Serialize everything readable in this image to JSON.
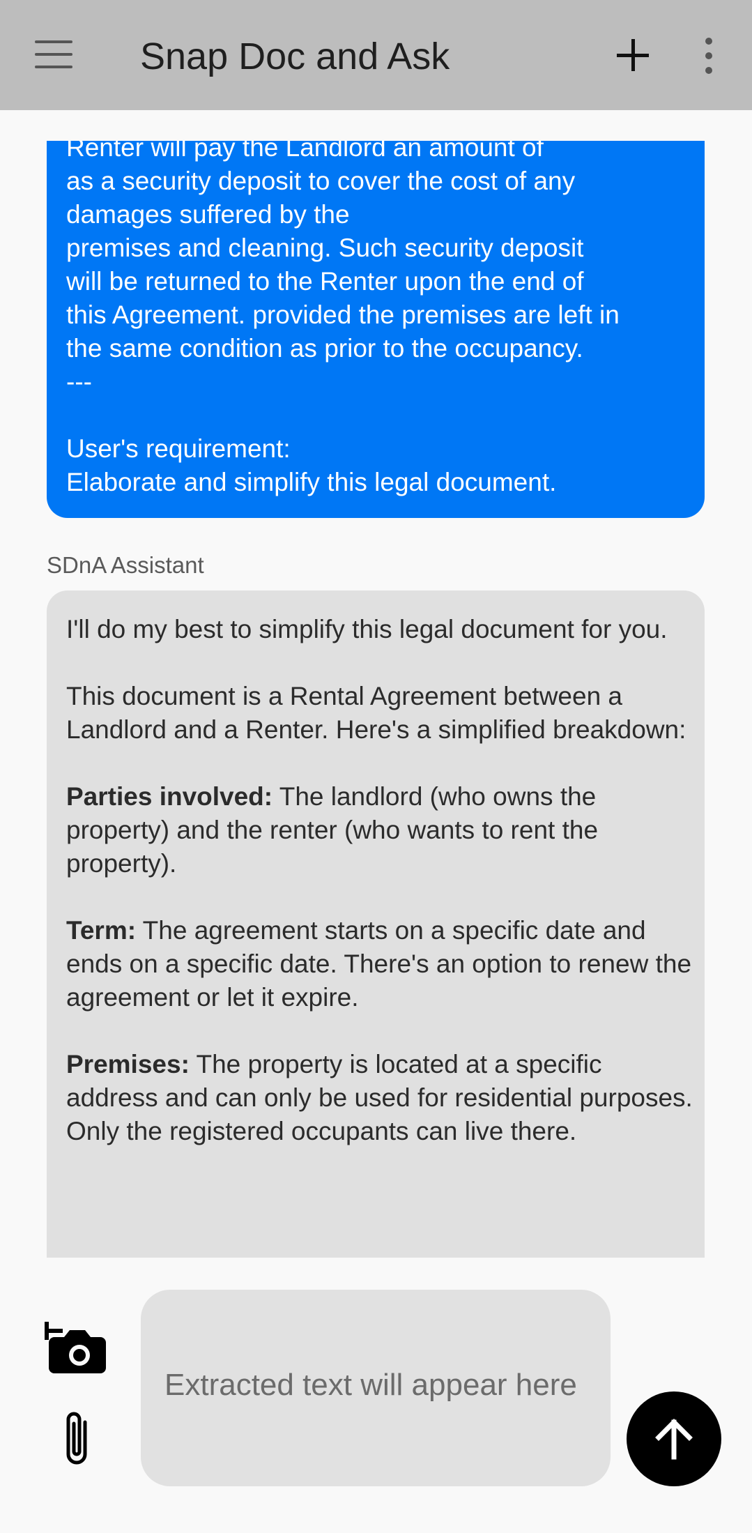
{
  "app_bar": {
    "title": "Snap Doc and Ask",
    "menu_icon": "hamburger-menu-icon",
    "add_icon": "plus-icon",
    "more_icon": "more-vert-icon"
  },
  "chat": {
    "user_message": "Renter will pay the Landlord an amount of\nas a security deposit to cover the cost of any\ndamages suffered by the\npremises and cleaning. Such security deposit\nwill be returned to the Renter upon the end of\nthis Agreement. provided the premises are left in\nthe same condition as prior to the occupancy.\n---\n\nUser's requirement:\nElaborate and simplify this legal document.",
    "assistant_label": "SDnA Assistant",
    "assistant_intro": "I'll do my best to simplify this legal document for you.",
    "assistant_overview": "This document is a Rental Agreement between a Landlord and a Renter. Here's a simplified breakdown:",
    "sections": [
      {
        "heading": "Parties involved:",
        "text": " The landlord (who owns the property) and the renter (who wants to rent the property)."
      },
      {
        "heading": "Term:",
        "text": " The agreement starts on a specific date and ends on a specific date. There's an option to renew the agreement or let it expire."
      },
      {
        "heading": "Premises:",
        "text": " The property is located at a specific address and can only be used for residential purposes. Only the registered occupants can live there."
      }
    ]
  },
  "composer": {
    "placeholder": "Extracted text will appear here",
    "camera_icon": "add-a-photo-icon",
    "attach_icon": "attach-file-icon",
    "send_icon": "arrow-upward-icon"
  },
  "colors": {
    "app_bar": "#bdbdbd",
    "user_bubble": "#0077f5",
    "assistant_bubble": "#e0e0e0",
    "send_button": "#000000"
  }
}
